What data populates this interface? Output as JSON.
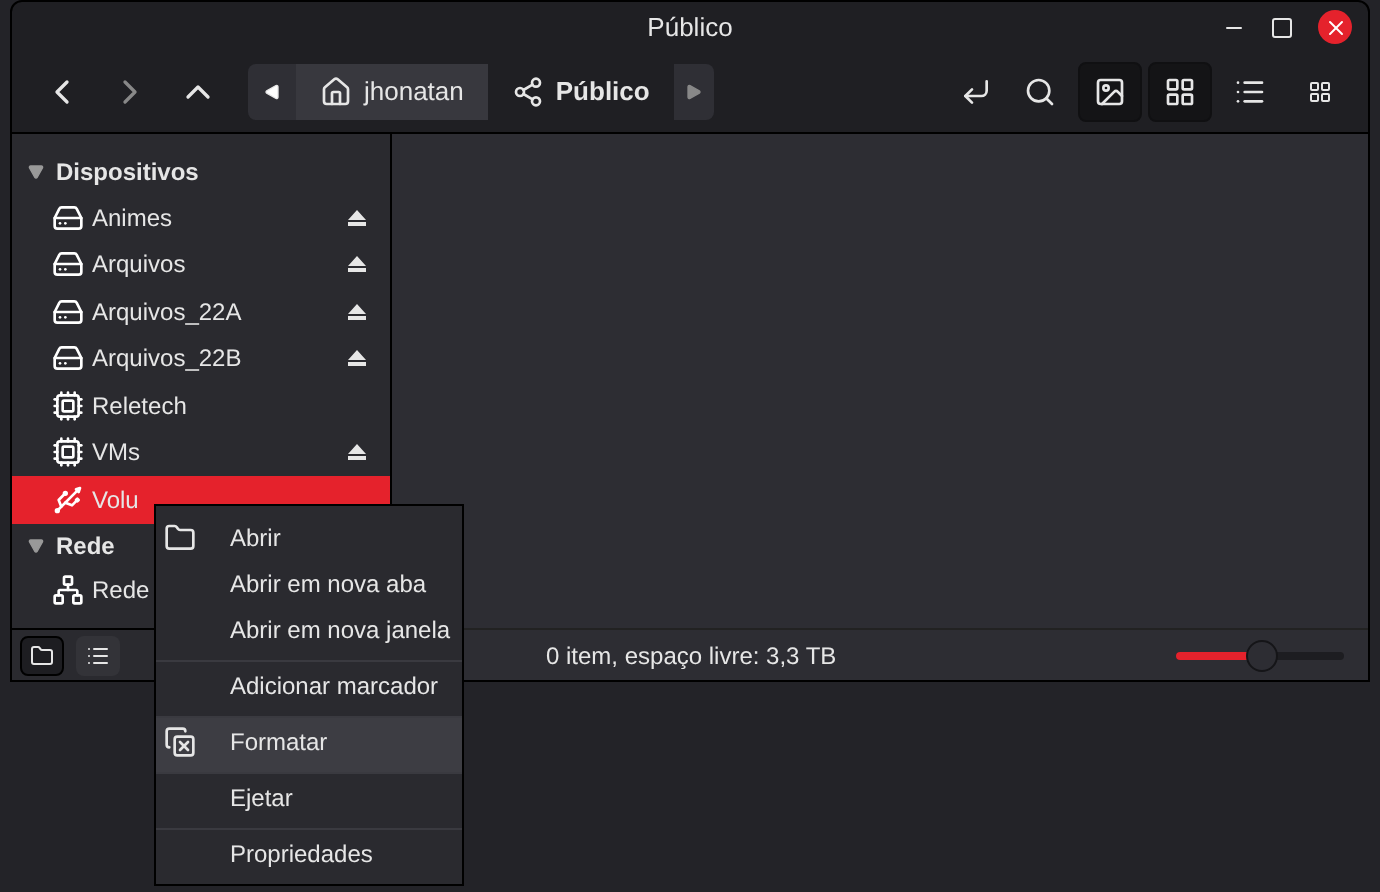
{
  "window": {
    "title": "Público"
  },
  "path": [
    {
      "label": "jhonatan",
      "kind": "home",
      "selected": false
    },
    {
      "label": "Público",
      "kind": "share",
      "selected": true
    }
  ],
  "view_buttons": [
    {
      "kind": "image",
      "selected": true
    },
    {
      "kind": "grid",
      "selected": true
    },
    {
      "kind": "list",
      "selected": false
    },
    {
      "kind": "compact",
      "selected": false
    }
  ],
  "sidebar": {
    "sections": [
      {
        "title": "Dispositivos",
        "expanded": true,
        "items": [
          {
            "label": "Animes",
            "kind": "disk",
            "eject": true,
            "selected": false
          },
          {
            "label": "Arquivos",
            "kind": "disk",
            "eject": true,
            "selected": false
          },
          {
            "label": "Arquivos_22A",
            "kind": "disk",
            "eject": true,
            "selected": false
          },
          {
            "label": "Arquivos_22B",
            "kind": "disk",
            "eject": true,
            "selected": false
          },
          {
            "label": "Reletech",
            "kind": "chip",
            "eject": false,
            "selected": false
          },
          {
            "label": "VMs",
            "kind": "chip",
            "eject": true,
            "selected": false
          },
          {
            "label": "Volu",
            "kind": "usb",
            "eject": false,
            "selected": true
          }
        ]
      },
      {
        "title": "Rede",
        "expanded": true,
        "items": [
          {
            "label": "Rede",
            "kind": "network",
            "eject": false,
            "selected": false
          }
        ]
      }
    ]
  },
  "status_bar": {
    "text": "0 item, espaço livre: 3,3 TB",
    "zoom": {
      "level": 0.45
    }
  },
  "context_menu": [
    {
      "label": "Abrir",
      "kind": "folder",
      "selected": false,
      "separator_after": false
    },
    {
      "label": "Abrir em nova aba",
      "selected": false,
      "separator_after": false
    },
    {
      "label": "Abrir em nova janela",
      "selected": false,
      "separator_after": true
    },
    {
      "label": "Adicionar marcador",
      "selected": false,
      "separator_after": true
    },
    {
      "label": "Formatar",
      "kind": "format",
      "selected": true,
      "separator_after": true
    },
    {
      "label": "Ejetar",
      "selected": false,
      "separator_after": true
    },
    {
      "label": "Propriedades",
      "selected": false,
      "separator_after": false
    }
  ]
}
